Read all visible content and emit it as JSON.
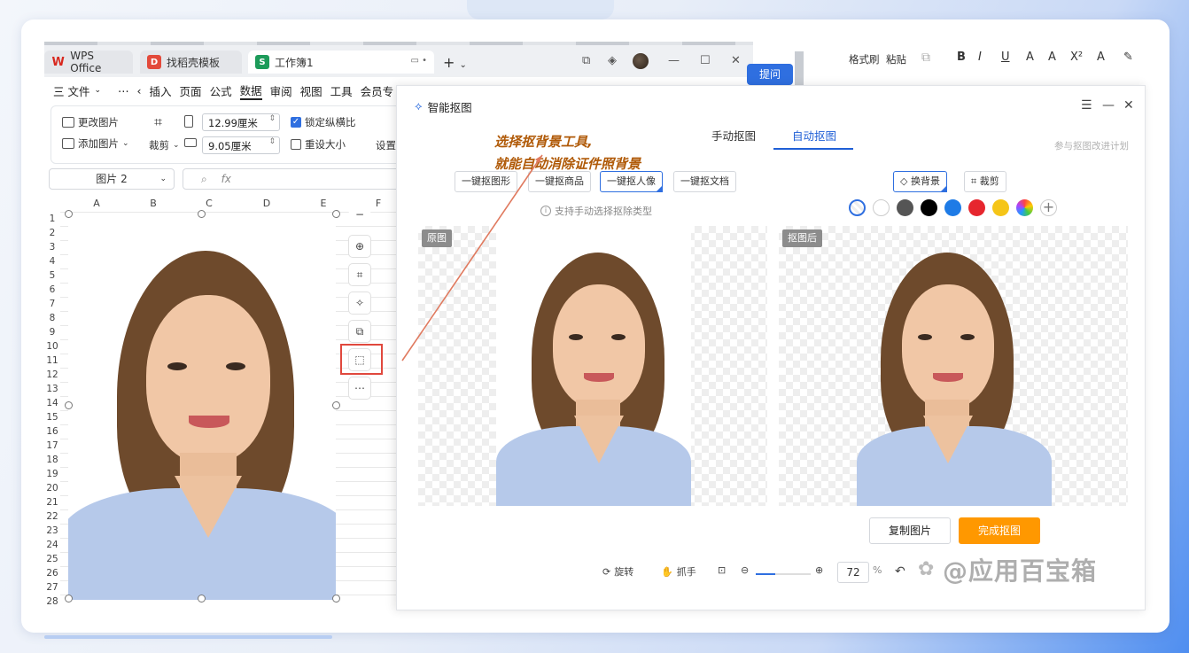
{
  "wps": {
    "tabs": [
      {
        "label": "WPS Office",
        "icon": "wps-logo-icon"
      },
      {
        "label": "找稻壳模板",
        "icon": "daoke-logo-icon"
      },
      {
        "label": "工作簿1",
        "icon": "sheet-s-icon"
      }
    ],
    "new_tab": "+",
    "menu": [
      "三 文件",
      "⋯",
      "插入",
      "页面",
      "公式",
      "数据",
      "审阅",
      "视图",
      "工具",
      "会员专"
    ],
    "menu_active": "数据",
    "ribbon": {
      "change_image": "更改图片",
      "add_image": "添加图片",
      "crop": "裁剪",
      "width_value": "12.99厘米",
      "height_value": "9.05厘米",
      "lock_ratio": "锁定纵横比",
      "reset_size": "重设大小",
      "settings": "设置"
    },
    "name_box": "图片 2",
    "fx": "fx",
    "columns": [
      "A",
      "B",
      "C",
      "D",
      "E",
      "F"
    ],
    "rows": [
      "1",
      "2",
      "3",
      "4",
      "5",
      "6",
      "7",
      "8",
      "9",
      "10",
      "11",
      "12",
      "13",
      "14",
      "15",
      "16",
      "17",
      "18",
      "19",
      "20",
      "21",
      "22",
      "23",
      "24",
      "25",
      "26",
      "27",
      "28"
    ],
    "right_toolbar": {
      "format_painter": "格式刷",
      "paste": "粘贴",
      "ask_button": "提问"
    }
  },
  "annotation": {
    "line1": "选择抠背景工具,",
    "line2": "就能自动消除证件照背景"
  },
  "dialog": {
    "title": "智能抠图",
    "tabs": [
      "手动抠图",
      "自动抠图"
    ],
    "active_tab": "自动抠图",
    "plan_link": "参与抠图改进计划",
    "modes": [
      "一键抠图形",
      "一键抠商品",
      "一键抠人像",
      "一键抠文档"
    ],
    "selected_mode": "一键抠人像",
    "hint": "支持手动选择抠除类型",
    "change_bg": "换背景",
    "crop": "裁剪",
    "swatches": [
      "transparent",
      "#ffffff",
      "#555555",
      "#000000",
      "#1e7be6",
      "#e6262e",
      "#f5c518",
      "rainbow"
    ],
    "original_label": "原图",
    "result_label": "抠图后",
    "copy_button": "复制图片",
    "finish_button": "完成抠图",
    "rotate": "旋转",
    "grab": "抓手",
    "zoom_value": "72",
    "zoom_unit": "%"
  },
  "watermark": "@应用百宝箱"
}
